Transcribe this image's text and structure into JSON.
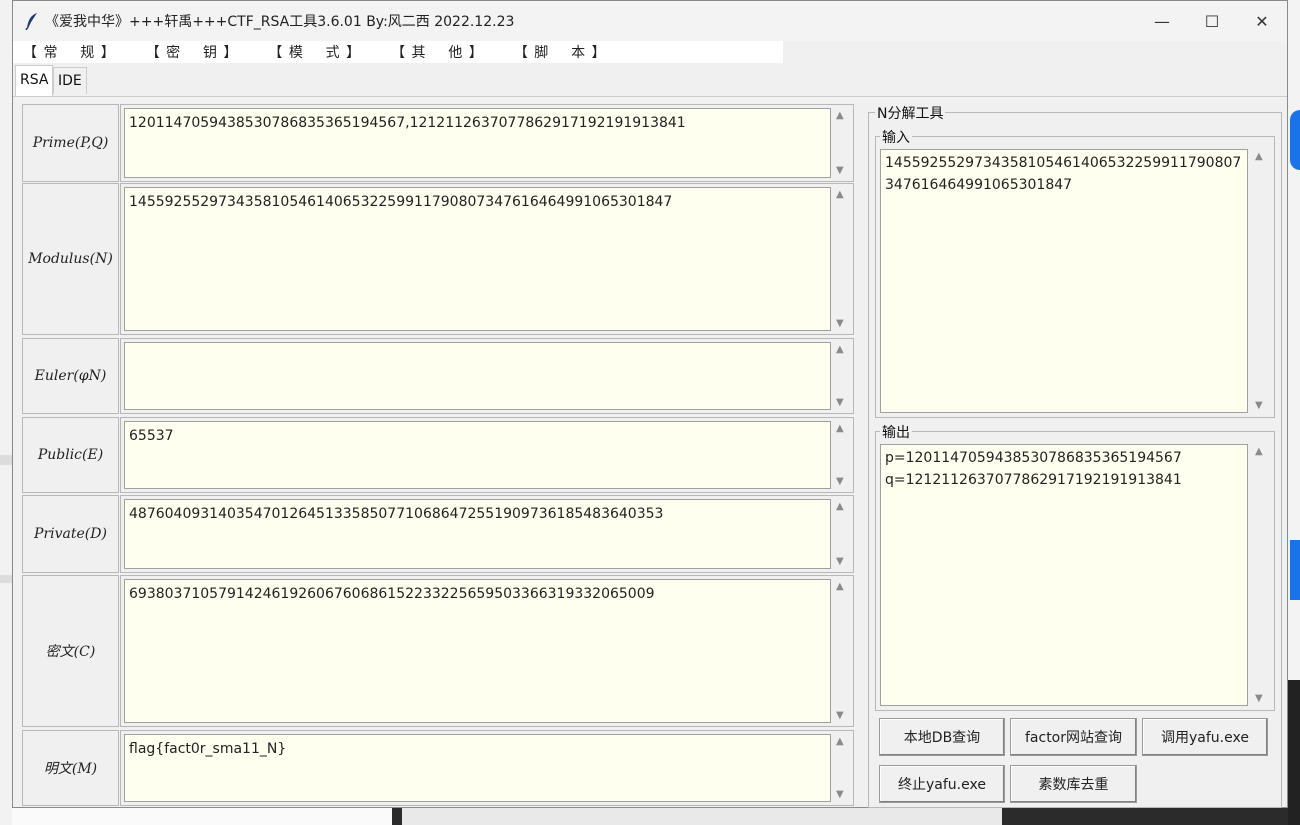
{
  "window": {
    "title": "《爱我中华》+++轩禹+++CTF_RSA工具3.6.01   By:风二西 2022.12.23",
    "minimize": "—",
    "maximize": "☐",
    "close": "✕"
  },
  "menu": [
    "【 常    规 】",
    "【 密    钥 】",
    "【 模    式 】",
    "【 其    他 】",
    "【 脚    本 】"
  ],
  "tabs": [
    "RSA",
    "IDE"
  ],
  "fields": [
    {
      "label": "Prime(P,Q)",
      "value": "120114705943853078683536519456​7,1212112637077862917192191913841"
    },
    {
      "label": "Modulus(N)",
      "value": "145592552973435810546140653225991179080734761646499106530184​7"
    },
    {
      "label": "Euler(φN)",
      "value": ""
    },
    {
      "label": "Public(E)",
      "value": "65537"
    },
    {
      "label": "Private(D)",
      "value": "487604093140354701264513358507710686472551909736185483640353"
    },
    {
      "label": "密文(C)",
      "value": "693803710579142461926067606861522332256595033663193320650​09"
    },
    {
      "label": "明文(M)",
      "value": "flag{fact0r_sma11_N}"
    }
  ],
  "nfactor": {
    "title": "N分解工具",
    "input_label": "输入",
    "input_value": "145592552973435810546140653225991179080734761646499106530184​7",
    "output_label": "输出",
    "output_value": "p=1201147059438530786835365194567\nq=1212112637077862917192191913841"
  },
  "buttons": {
    "local_db": "本地DB查询",
    "factor_web": "factor网站查询",
    "call_yafu": "调用yafu.exe",
    "stop_yafu": "终止yafu.exe",
    "prime_dedup": "素数库去重"
  }
}
